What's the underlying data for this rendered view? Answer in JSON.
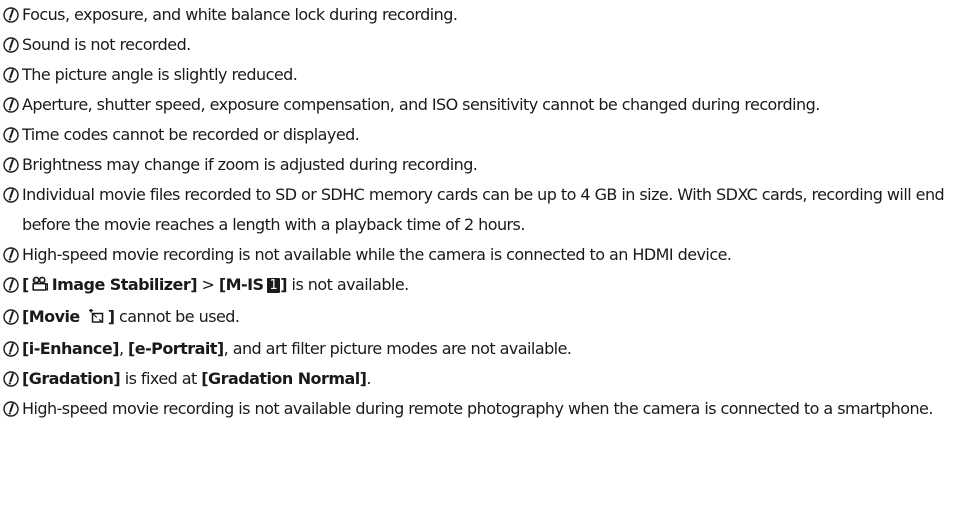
{
  "icon": "caution-icon",
  "notes": [
    {
      "text": "Focus, exposure, and white balance lock during recording."
    },
    {
      "text": "Sound is not recorded."
    },
    {
      "text": "The picture angle is slightly reduced."
    },
    {
      "text": "Aperture, shutter speed, exposure compensation, and ISO sensitivity cannot be changed during recording."
    },
    {
      "text": "Time codes cannot be recorded or displayed."
    },
    {
      "text": "Brightness may change if zoom is adjusted during recording."
    },
    {
      "text": "Individual movie files recorded to SD or SDHC memory cards can be up to 4 GB in size. With SDXC cards, recording will end before the movie reaches a length with a playback time of 2 hours."
    },
    {
      "text": "High-speed movie recording is not available while the camera is connected to an HDMI device."
    },
    {
      "open_bracket": "[",
      "setting": "Image Stabilizer]",
      "separator": " > ",
      "option": "[M-IS",
      "option_number": "1",
      "option_close": "]",
      "suffix": " is not available.",
      "movie_icon": "movie-camera-icon"
    },
    {
      "setting": "[Movie",
      "setting_close": "]",
      "suffix": " cannot be used.",
      "crop_icon": "crop-frame-icon"
    },
    {
      "item1": "[i-Enhance]",
      "sep1": ", ",
      "item2": "[e-Portrait]",
      "suffix": ", and art filter picture modes are not available."
    },
    {
      "item": "[Gradation]",
      "middle": " is fixed at ",
      "value": "[Gradation Normal]",
      "end": "."
    },
    {
      "text": "High-speed movie recording is not available during remote photography when the camera is connected to a smartphone."
    }
  ]
}
